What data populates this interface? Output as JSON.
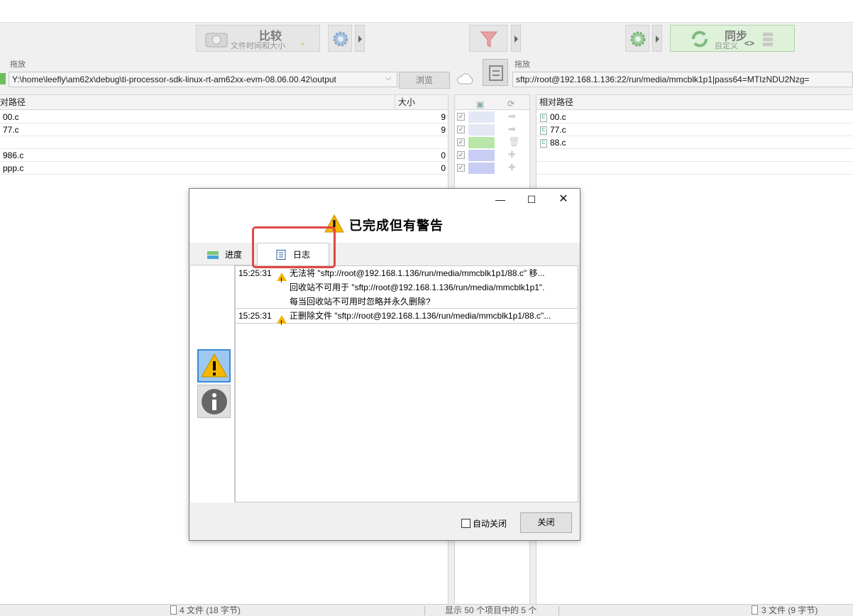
{
  "toolbar": {
    "compare_label": "比较",
    "compare_sub": "文件时间和大小",
    "sync_label": "同步",
    "sync_sub": "自定义"
  },
  "left": {
    "drop_label": "拖放",
    "path": "Y:\\home\\leefly\\am62x\\debug\\ti-processor-sdk-linux-rt-am62xx-evm-08.06.00.42\\output",
    "browse": "浏览",
    "col_path": "对路径",
    "col_size": "大小",
    "rows": [
      {
        "name": "00.c",
        "size": "9"
      },
      {
        "name": "77.c",
        "size": "9"
      },
      {
        "name": "",
        "size": ""
      },
      {
        "name": "986.c",
        "size": "0"
      },
      {
        "name": "ppp.c",
        "size": "0"
      }
    ]
  },
  "right": {
    "drop_label": "拖放",
    "path": "sftp://root@192.168.1.136:22/run/media/mmcblk1p1|pass64=MTIzNDU2Nzg=",
    "col_path": "相对路径",
    "rows": [
      {
        "name": "00.c"
      },
      {
        "name": "77.c"
      },
      {
        "name": "88.c"
      }
    ]
  },
  "dialog": {
    "title": "已完成但有警告",
    "tab_progress": "进度",
    "tab_log": "日志",
    "log": [
      {
        "time": "15:25:31",
        "lines": [
          "无法将 \"sftp://root@192.168.1.136/run/media/mmcblk1p1/88.c\" 移...",
          "回收站不可用于 \"sftp://root@192.168.1.136/run/media/mmcblk1p1\".",
          "每当回收站不可用时忽略并永久删除?"
        ]
      },
      {
        "time": "15:25:31",
        "lines": [
          "正删除文件 \"sftp://root@192.168.1.136/run/media/mmcblk1p1/88.c\"..."
        ]
      }
    ],
    "auto_close": "自动关闭",
    "close": "关闭"
  },
  "status": {
    "left": "4 文件 (18 字节)",
    "middle": "显示 50 个项目中的 5 个",
    "right": "3 文件 (9 字节)"
  }
}
